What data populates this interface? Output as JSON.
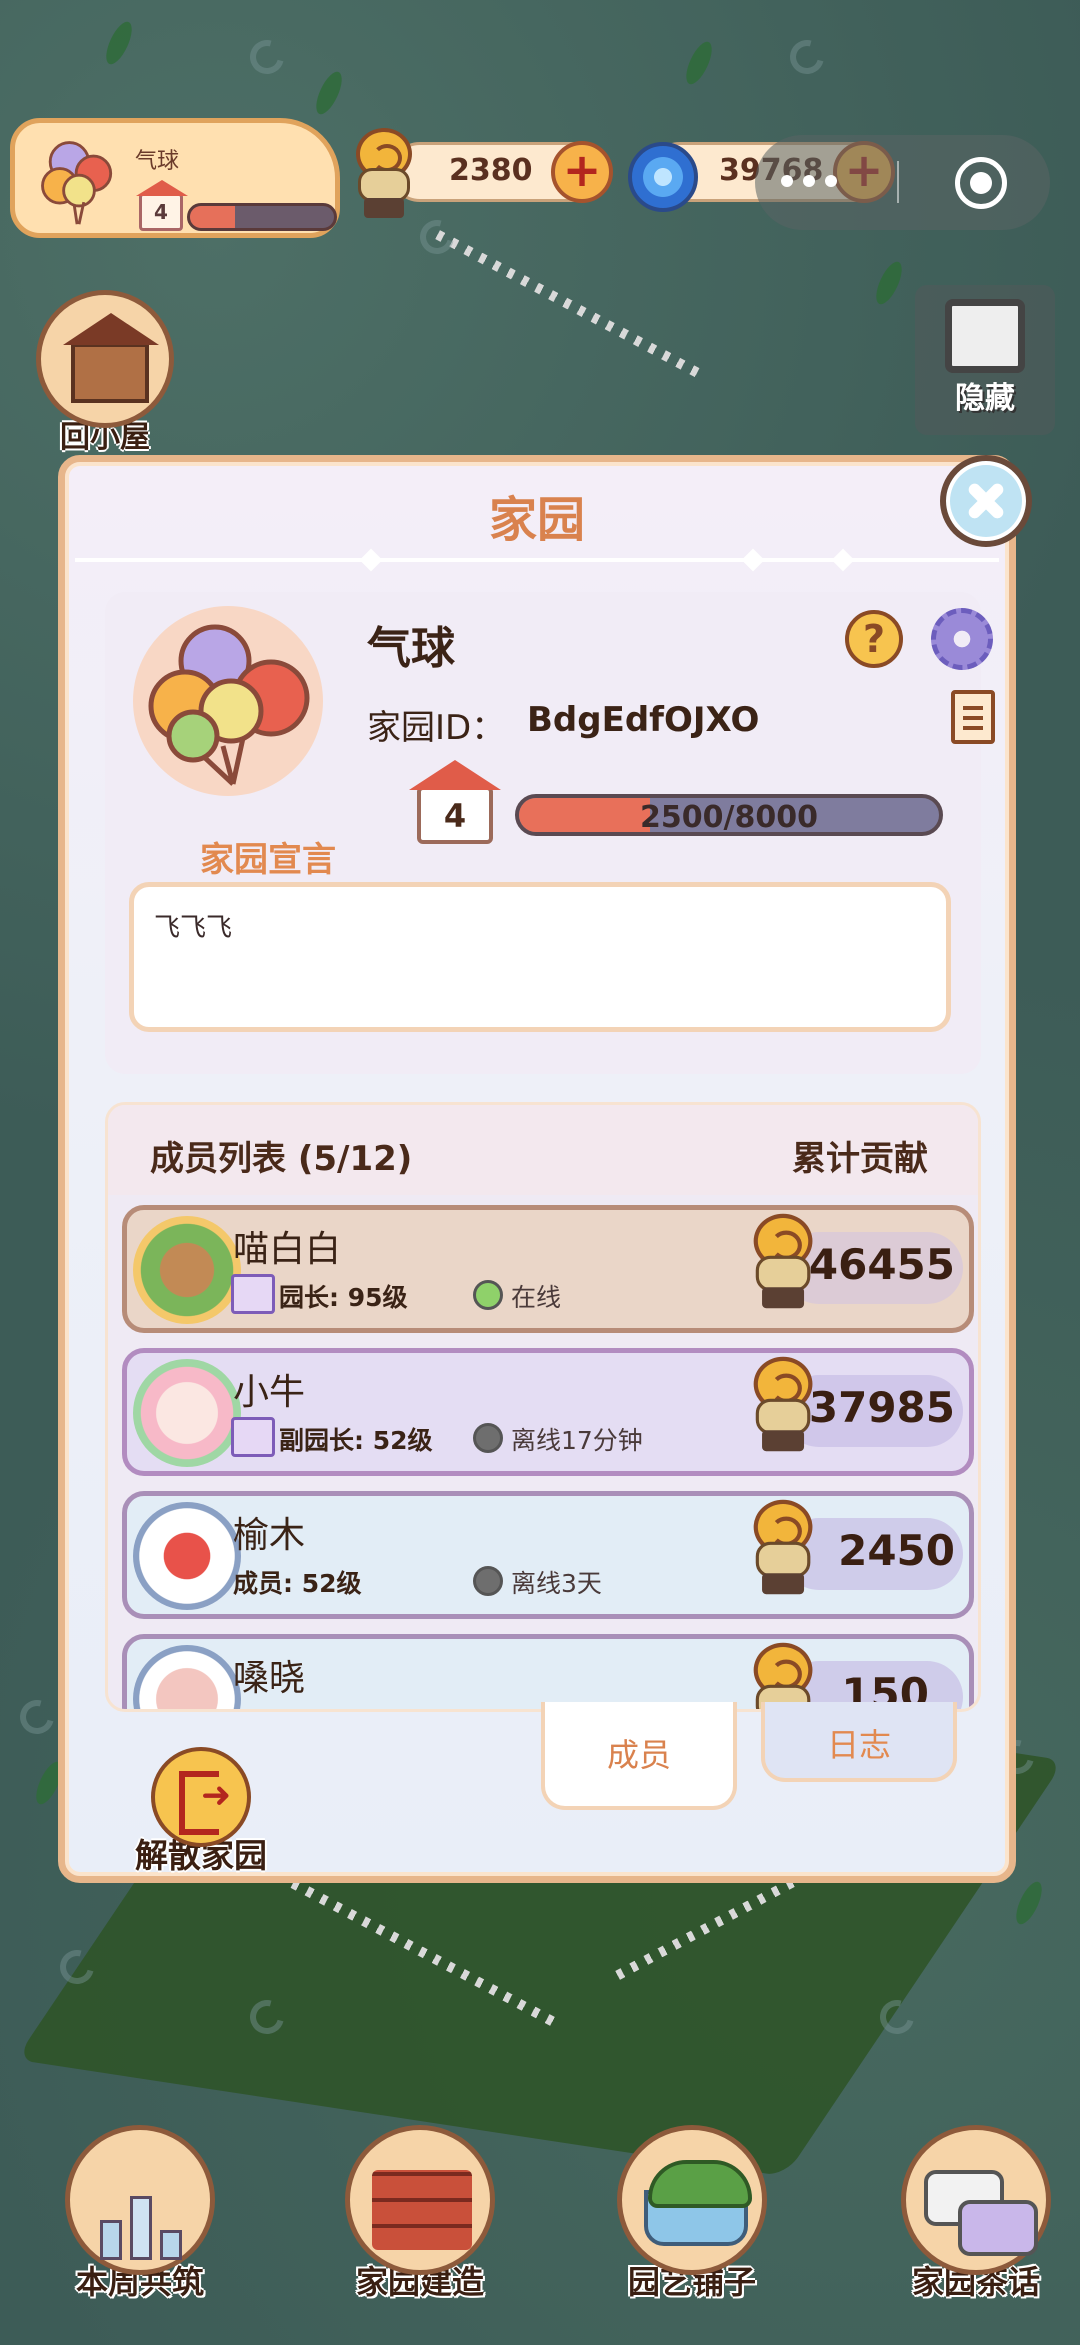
{
  "hud": {
    "profile_name": "气球",
    "profile_level": "4",
    "profile_exp_fraction": 0.3125,
    "coins": "2380",
    "gems": "39768"
  },
  "side": {
    "home_label": "回小屋",
    "hide_label": "隐藏"
  },
  "dialog": {
    "title": "家园",
    "home_name": "气球",
    "id_label": "家园ID：",
    "id_value": "BdgEdfOJXO",
    "level": "4",
    "exp_text": "2500/8000",
    "exp_fraction": 0.3125,
    "manifesto_label": "家园宣言",
    "manifesto_text": "飞飞飞",
    "members_header": "成员列表 (5/12)",
    "contribution_header": "累计贡献",
    "members": [
      {
        "name": "喵白白",
        "role": "园长: 95级",
        "status": "在线",
        "score": "46455"
      },
      {
        "name": "小牛",
        "role": "副园长: 52级",
        "status": "离线17分钟",
        "score": "37985"
      },
      {
        "name": "榆木",
        "role": "成员: 52级",
        "status": "离线3天",
        "score": "2450"
      },
      {
        "name": "嗓晓",
        "role": "",
        "status": "",
        "score": "150"
      }
    ],
    "tab_members": "成员",
    "tab_log": "日志",
    "disband_label": "解散家园"
  },
  "bottom_nav": {
    "weekly": "本周共筑",
    "build": "家园建造",
    "garden": "园艺铺子",
    "chat": "家园茶话"
  },
  "colors": {
    "dialog_title": "#d9824e",
    "online": "#8fd16a",
    "offline": "#6e6e6e",
    "exp_fill": "#e8705a"
  }
}
